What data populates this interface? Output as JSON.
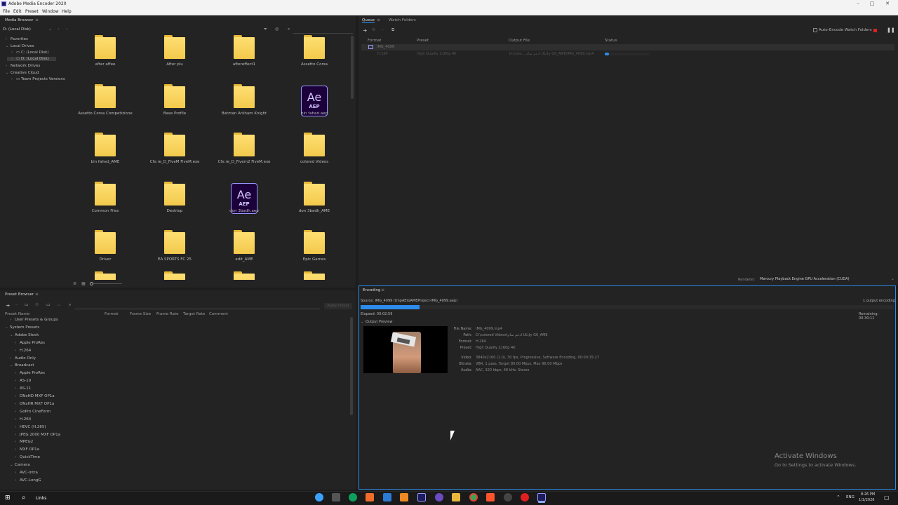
{
  "window": {
    "title": "Adobe Media Encoder 2020"
  },
  "menu": [
    "File",
    "Edit",
    "Preset",
    "Window",
    "Help"
  ],
  "media_browser": {
    "tab_label": "Media Browser",
    "drive_select": "D: (Local Disk)",
    "tree": [
      {
        "label": "Favorites",
        "level": 0
      },
      {
        "label": "Local Drives",
        "level": 0
      },
      {
        "label": "C: (Local Disk)",
        "level": 1
      },
      {
        "label": "D: (Local Disk)",
        "level": 1
      },
      {
        "label": "Network Drives",
        "level": 0
      },
      {
        "label": "Creative Cloud",
        "level": 0
      },
      {
        "label": "Team Projects Versions",
        "level": 1
      }
    ],
    "items": [
      {
        "label": "after affee",
        "type": "folder"
      },
      {
        "label": "After plu",
        "type": "folder"
      },
      {
        "label": "aftereffect1",
        "type": "folder"
      },
      {
        "label": "Assetto Corsa",
        "type": "folder"
      },
      {
        "label": "Assetto Corsa Competizione",
        "type": "folder"
      },
      {
        "label": "Base Profile",
        "type": "folder"
      },
      {
        "label": "Batman Arkham Knight",
        "type": "folder"
      },
      {
        "label": "bin fahed.aep",
        "type": "aep"
      },
      {
        "label": "bin fahed_AME",
        "type": "folder"
      },
      {
        "label": "Cfx:re_D_FiveM FiveM.exe",
        "type": "folder"
      },
      {
        "label": "Cfx:re_D_Fivem2 FiveM.exe",
        "type": "folder"
      },
      {
        "label": "colored Videos",
        "type": "folder"
      },
      {
        "label": "Common Files",
        "type": "folder"
      },
      {
        "label": "Desktop",
        "type": "folder"
      },
      {
        "label": "don 3badh.aep",
        "type": "aep"
      },
      {
        "label": "don 3badh_AME",
        "type": "folder"
      },
      {
        "label": "Driver",
        "type": "folder"
      },
      {
        "label": "EA SPORTS FC 25",
        "type": "folder"
      },
      {
        "label": "edit_AME",
        "type": "folder"
      },
      {
        "label": "Epic Games",
        "type": "folder"
      }
    ],
    "aep_icon_text": {
      "ae": "Ae",
      "ext": "AEP"
    }
  },
  "queue": {
    "tabs": [
      "Queue",
      "Watch Folders"
    ],
    "auto_encode_label": "Auto-Encode Watch Folders",
    "columns": [
      "Format",
      "Preset",
      "Output File",
      "Status"
    ],
    "item_name": "IMG_4099",
    "row": {
      "format": "H.264",
      "preset": "High Quality 2160p 4K",
      "output": "D:\\colo... ادعم سام UL\\ty G6_AME\\IMG_4099.mp4"
    },
    "renderer_label": "Renderer:",
    "renderer_value": "Mercury Playback Engine GPU Acceleration (CUDA)"
  },
  "preset_browser": {
    "tab_label": "Preset Browser",
    "apply_button": "Apply Preset",
    "columns": [
      "Preset Name",
      "Format",
      "Frame Size",
      "Frame Rate",
      "Target Rate",
      "Comment"
    ],
    "tree": [
      {
        "label": "User Presets & Groups",
        "level": 1
      },
      {
        "label": "System Presets",
        "level": 0
      },
      {
        "label": "Adobe Stock",
        "level": 1
      },
      {
        "label": "Apple ProRes",
        "level": 2
      },
      {
        "label": "H.264",
        "level": 2
      },
      {
        "label": "Audio Only",
        "level": 1
      },
      {
        "label": "Broadcast",
        "level": 1
      },
      {
        "label": "Apple ProRes",
        "level": 2
      },
      {
        "label": "AS-10",
        "level": 2
      },
      {
        "label": "AS-11",
        "level": 2
      },
      {
        "label": "DNxHD MXF OP1a",
        "level": 2
      },
      {
        "label": "DNxHR MXF OP1a",
        "level": 2
      },
      {
        "label": "GoPro CineForm",
        "level": 2
      },
      {
        "label": "H.264",
        "level": 2
      },
      {
        "label": "HEVC (H.265)",
        "level": 2
      },
      {
        "label": "JPEG 2000 MXF OP1a",
        "level": 2
      },
      {
        "label": "MPEG2",
        "level": 2
      },
      {
        "label": "MXF OP1a",
        "level": 2
      },
      {
        "label": "QuickTime",
        "level": 2
      },
      {
        "label": "Camera",
        "level": 1
      },
      {
        "label": "AVC-Intra",
        "level": 2
      },
      {
        "label": "AVC-LongG",
        "level": 2
      }
    ]
  },
  "encoding": {
    "tab_label": "Encoding",
    "source": "Source: IMG_4099 (tmpAEtoAMEProject-IMG_4099.aep)",
    "output_count": "1 output encoding",
    "elapsed": "Elapsed: 00:02:59",
    "remaining": "Remaining: 00:30:11",
    "progress": 0.11,
    "output_preview_label": "Output Preview",
    "info": [
      {
        "k": "File Name:",
        "v": "IMG_4099.mp4"
      },
      {
        "k": "Path:",
        "v": "D:\\colored Videos\\ادعم سام UL\\ty G6_AME"
      },
      {
        "k": "Format:",
        "v": "H.264"
      },
      {
        "k": "Preset:",
        "v": "High Quality 2160p 4K"
      },
      {
        "k": "Video:",
        "v": "3840x2160 (1.0), 30 fps, Progressive, Software Encoding, 00:00:15:27"
      },
      {
        "k": "Bitrate:",
        "v": "VBR, 1 pass, Target 80.00 Mbps, Max 96.00 Mbps"
      },
      {
        "k": "Audio:",
        "v": "AAC, 320 kbps, 48 kHz, Stereo"
      }
    ]
  },
  "watermark": {
    "line1": "Activate Windows",
    "line2": "Go to Settings to activate Windows."
  },
  "taskbar": {
    "search": "Links",
    "lang": "ENG",
    "time": "8:26 PM",
    "date": "1/1/2026"
  },
  "colors": {
    "accent": "#2d8ceb",
    "panel": "#232323",
    "folder": "#f2c94c",
    "stop": "#e02020"
  }
}
